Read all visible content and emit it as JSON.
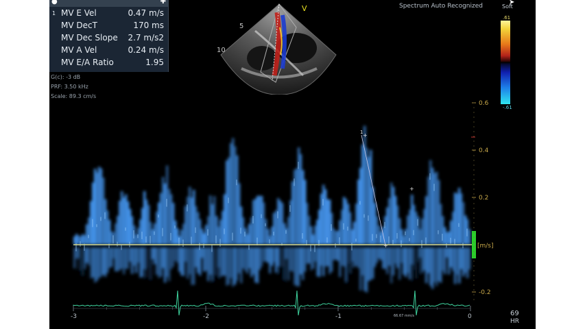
{
  "measurements": [
    {
      "label": "MV E Vel",
      "value": "0.47 m/s"
    },
    {
      "label": "MV DecT",
      "value": "170 ms"
    },
    {
      "label": "MV Dec Slope",
      "value": "2.7 m/s2"
    },
    {
      "label": "MV A Vel",
      "value": "0.24 m/s"
    },
    {
      "label": "MV E/A Ratio",
      "value": "1.95"
    }
  ],
  "measurement_index": "1",
  "settings": {
    "gain": "G(c): -3 dB",
    "prf": "PRF: 3.50 kHz",
    "scale": "Scale: 89.3 cm/s"
  },
  "status": "Spectrum Auto Recognized",
  "map_name": "Soft",
  "colorbar": {
    "top": ".61",
    "bottom": "-.61"
  },
  "sector": {
    "orientation_marker": "V",
    "depth_5": "5",
    "depth_10": "10"
  },
  "velocity_axis": {
    "ticks": [
      "0.6",
      "0.4",
      "0.2",
      "-0.2"
    ],
    "unit": "[m/s]"
  },
  "time_axis": {
    "ticks": [
      "-3",
      "-2",
      "-1",
      "0"
    ]
  },
  "cursor_label": "1",
  "ecg_label": "66.67 mm/s",
  "heart_rate": {
    "value": "69",
    "label": "HR"
  },
  "colors": {
    "spectrum": "#4aa0ff",
    "baseline": "#d8d88a",
    "ecg": "#3fd6a0",
    "axis": "#c8a84a",
    "accent_green": "#2ad02a"
  }
}
